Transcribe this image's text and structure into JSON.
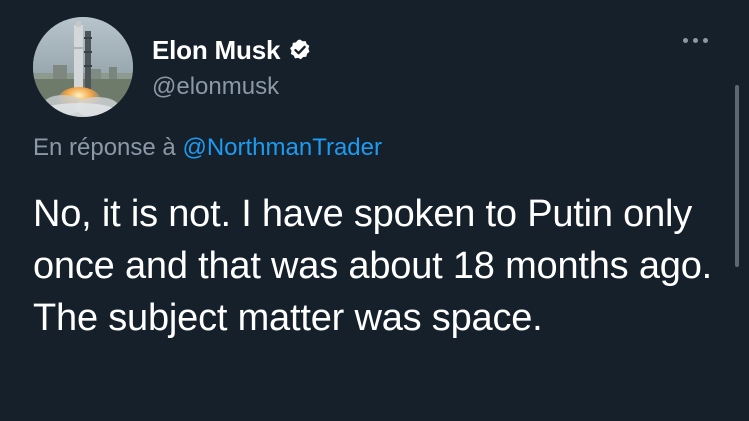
{
  "author": {
    "display_name": "Elon Musk",
    "handle": "@elonmusk",
    "verified": true,
    "avatar": "rocket-launch-photo"
  },
  "reply_context": {
    "prefix": "En réponse à",
    "mention": "@NorthmanTrader"
  },
  "tweet": {
    "text": "No, it is not. I have spoken to Putin only once and that was about 18 months ago. The subject matter was space."
  },
  "icons": {
    "more": "more-horizontal-icon",
    "verified": "verified-badge-icon"
  },
  "colors": {
    "background": "#15202b",
    "secondary_text": "#8b98a5",
    "link": "#1d9bf0",
    "verified_badge": "#ffffff"
  }
}
